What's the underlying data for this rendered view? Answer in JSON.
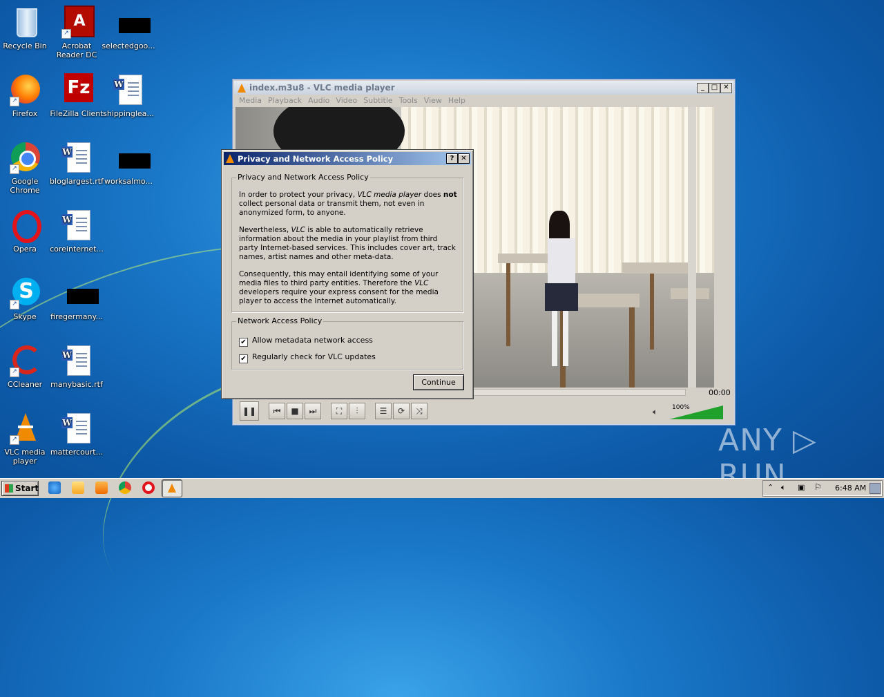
{
  "desktop": {
    "icons": [
      {
        "label": "Recycle Bin"
      },
      {
        "label": "Acrobat Reader DC"
      },
      {
        "label": "selectedgoo..."
      },
      {
        "label": "Firefox"
      },
      {
        "label": "FileZilla Client"
      },
      {
        "label": "shippinglea..."
      },
      {
        "label": "Google Chrome"
      },
      {
        "label": "bloglargest.rtf"
      },
      {
        "label": "worksalmo..."
      },
      {
        "label": "Opera"
      },
      {
        "label": "coreinternet..."
      },
      {
        "label": "Skype"
      },
      {
        "label": "firegermany..."
      },
      {
        "label": "CCleaner"
      },
      {
        "label": "manybasic.rtf"
      },
      {
        "label": "VLC media player"
      },
      {
        "label": "mattercourt..."
      }
    ]
  },
  "vlc": {
    "title": "index.m3u8 - VLC media player",
    "menu": [
      "Media",
      "Playback",
      "Audio",
      "Video",
      "Subtitle",
      "Tools",
      "View",
      "Help"
    ],
    "time": "00:00",
    "volume": "100%",
    "volume_level": 1.0
  },
  "dialog": {
    "title": "Privacy and Network Access Policy",
    "help_button": "?",
    "close_button": "✕",
    "group1_title": "Privacy and Network Access Policy",
    "p1_a": "In order to protect your privacy, ",
    "p1_b": "VLC media player",
    "p1_c": " does ",
    "p1_d": "not",
    "p1_e": " collect personal data or transmit them, not even in anonymized form, to anyone.",
    "p2_a": "Nevertheless, ",
    "p2_b": "VLC",
    "p2_c": " is able to automatically retrieve information about the media in your playlist from third party Internet-based services. This includes cover art, track names, artist names and other meta-data.",
    "p3_a": "Consequently, this may entail identifying some of your media files to third party entities. Therefore the ",
    "p3_b": "VLC",
    "p3_c": " developers require your express consent for the media player to access the Internet automatically.",
    "group2_title": "Network Access Policy",
    "check1": "Allow metadata network access",
    "check2": "Regularly check for VLC updates",
    "check_mark": "✔",
    "continue": "Continue"
  },
  "taskbar": {
    "start": "Start",
    "clock": "6:48 AM"
  },
  "watermark": "ANY ▷ RUN"
}
